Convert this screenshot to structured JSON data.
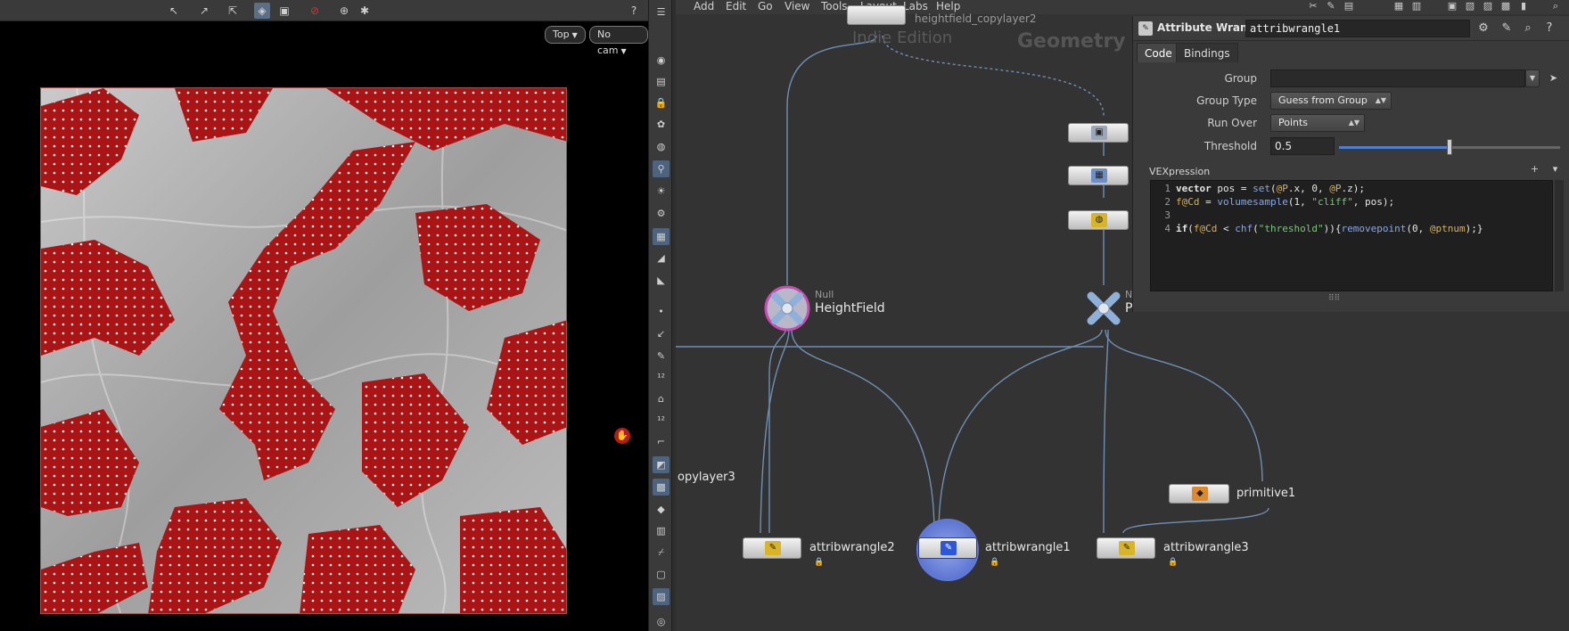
{
  "menu": [
    "Add",
    "Edit",
    "Go",
    "View",
    "Tools",
    "Layout",
    "Labs",
    "Help"
  ],
  "viewport": {
    "view_drop": "Top",
    "cam_drop": "No cam"
  },
  "network": {
    "watermark": "Geometry",
    "watermark_small": "Indie Edition",
    "nodes": {
      "copylayer2": "heightfield_copylayer2",
      "copylayer3": "opylayer3",
      "heightfield_null_type": "Null",
      "heightfield_null_name": "HeightField",
      "right_null_type": "N",
      "right_null_name": "P",
      "primitive1": "primitive1",
      "attribwrangle2": "attribwrangle2",
      "attribwrangle1": "attribwrangle1",
      "attribwrangle3": "attribwrangle3"
    }
  },
  "params": {
    "op_type": "Attribute Wrangle",
    "op_name": "attribwrangle1",
    "tabs": [
      "Code",
      "Bindings"
    ],
    "group_label": "Group",
    "group_value": "",
    "group_type_label": "Group Type",
    "group_type_value": "Guess from Group",
    "run_over_label": "Run Over",
    "run_over_value": "Points",
    "threshold_label": "Threshold",
    "threshold_value": "0.5",
    "threshold_fraction": 0.5,
    "vex_label": "VEXpression",
    "code_lines": [
      "1",
      "2",
      "3",
      "4"
    ]
  },
  "colors": {
    "selection": "#5a6e86",
    "node_selected": "#4a63c8",
    "terrain_mask": "#cc1d1d",
    "wire": "#6f8fb4"
  }
}
